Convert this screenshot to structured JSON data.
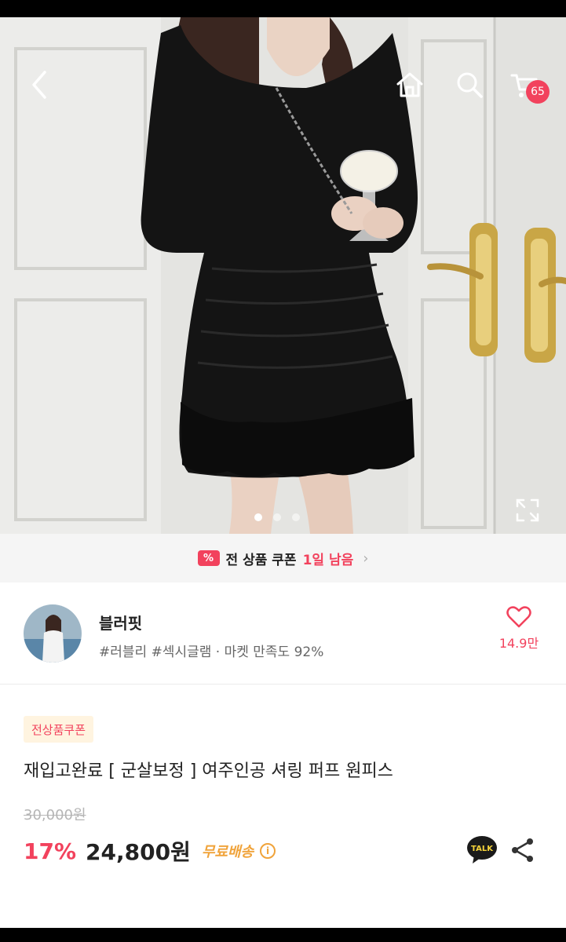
{
  "header": {
    "back_icon": "chevron-left-icon",
    "home_icon": "home-icon",
    "search_icon": "search-icon",
    "cart_icon": "cart-icon",
    "cart_count": "65"
  },
  "gallery": {
    "expand_icon": "expand-icon",
    "total_images": 3,
    "active_index": 0
  },
  "coupon_banner": {
    "icon": "%",
    "label": "전 상품 쿠폰",
    "remaining": "1일 남음"
  },
  "store": {
    "name": "블러핏",
    "meta": "#러블리 #섹시글램 · 마켓 만족도 92%",
    "likes": "14.9만"
  },
  "product": {
    "badge": "전상품쿠폰",
    "title": "재입고완료 [ 군살보정 ] 여주인공 셔링 퍼프 원피스",
    "original_price": "30,000원",
    "discount": "17%",
    "price": "24,800원",
    "shipping": "무료배송",
    "info_icon": "i",
    "talk_label": "TALK"
  },
  "colors": {
    "accent": "#f2425d",
    "shipping": "#f0a33a"
  }
}
